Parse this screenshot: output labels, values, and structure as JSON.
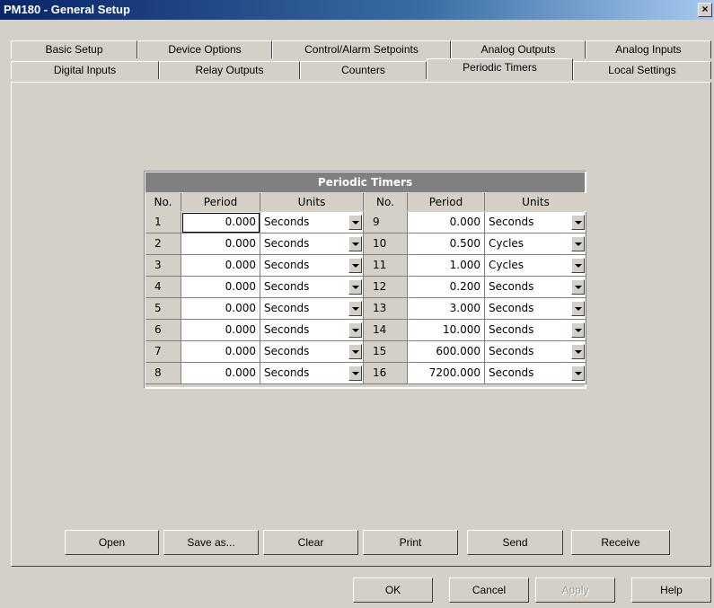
{
  "window": {
    "title": "PM180 - General Setup",
    "close_label": "×"
  },
  "tabs": {
    "row1": [
      "Basic Setup",
      "Device Options",
      "Control/Alarm Setpoints",
      "Analog Outputs",
      "Analog Inputs"
    ],
    "row2": [
      "Digital Inputs",
      "Relay Outputs",
      "Counters",
      "Periodic Timers",
      "Local Settings"
    ],
    "active": "Periodic Timers"
  },
  "table": {
    "title": "Periodic Timers",
    "headers": [
      "No.",
      "Period",
      "Units",
      "No.",
      "Period",
      "Units"
    ],
    "rows": [
      {
        "l_no": "1",
        "l_period": "0.000",
        "l_units": "Seconds",
        "r_no": "9",
        "r_period": "0.000",
        "r_units": "Seconds"
      },
      {
        "l_no": "2",
        "l_period": "0.000",
        "l_units": "Seconds",
        "r_no": "10",
        "r_period": "0.500",
        "r_units": "Cycles"
      },
      {
        "l_no": "3",
        "l_period": "0.000",
        "l_units": "Seconds",
        "r_no": "11",
        "r_period": "1.000",
        "r_units": "Cycles"
      },
      {
        "l_no": "4",
        "l_period": "0.000",
        "l_units": "Seconds",
        "r_no": "12",
        "r_period": "0.200",
        "r_units": "Seconds"
      },
      {
        "l_no": "5",
        "l_period": "0.000",
        "l_units": "Seconds",
        "r_no": "13",
        "r_period": "3.000",
        "r_units": "Seconds"
      },
      {
        "l_no": "6",
        "l_period": "0.000",
        "l_units": "Seconds",
        "r_no": "14",
        "r_period": "10.000",
        "r_units": "Seconds"
      },
      {
        "l_no": "7",
        "l_period": "0.000",
        "l_units": "Seconds",
        "r_no": "15",
        "r_period": "600.000",
        "r_units": "Seconds"
      },
      {
        "l_no": "8",
        "l_period": "0.000",
        "l_units": "Seconds",
        "r_no": "16",
        "r_period": "7200.000",
        "r_units": "Seconds"
      }
    ]
  },
  "actions": {
    "open": "Open",
    "save_as": "Save as...",
    "clear": "Clear",
    "print": "Print",
    "send": "Send",
    "receive": "Receive"
  },
  "dialog": {
    "ok": "OK",
    "cancel": "Cancel",
    "apply": "Apply",
    "help": "Help"
  }
}
